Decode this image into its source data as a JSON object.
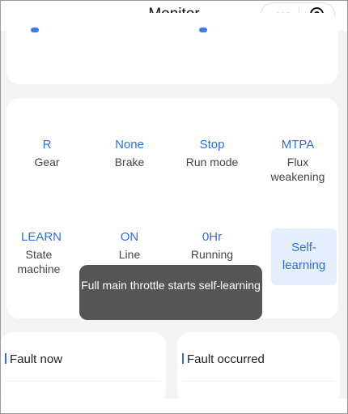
{
  "header": {
    "title": "Monitor",
    "more_label": "•••"
  },
  "status_grid": [
    {
      "value": "R",
      "label": "Gear"
    },
    {
      "value": "None",
      "label": "Brake"
    },
    {
      "value": "Stop",
      "label": "Run mode"
    },
    {
      "value": "MTPA",
      "label": "Flux weakening"
    },
    {
      "value": "LEARN",
      "label": "State machine"
    },
    {
      "value": "ON",
      "label": "Line"
    },
    {
      "value": "0Hr",
      "label": "Running"
    }
  ],
  "self_learning_button": "Self-\nlearning",
  "toast": "Full main throttle starts self-learning",
  "panels": {
    "fault_now": "Fault now",
    "fault_occurred": "Fault occurred"
  },
  "colors": {
    "accent": "#2f6fe4",
    "toast_bg": "#555555",
    "button_bg": "#e4eefc"
  }
}
